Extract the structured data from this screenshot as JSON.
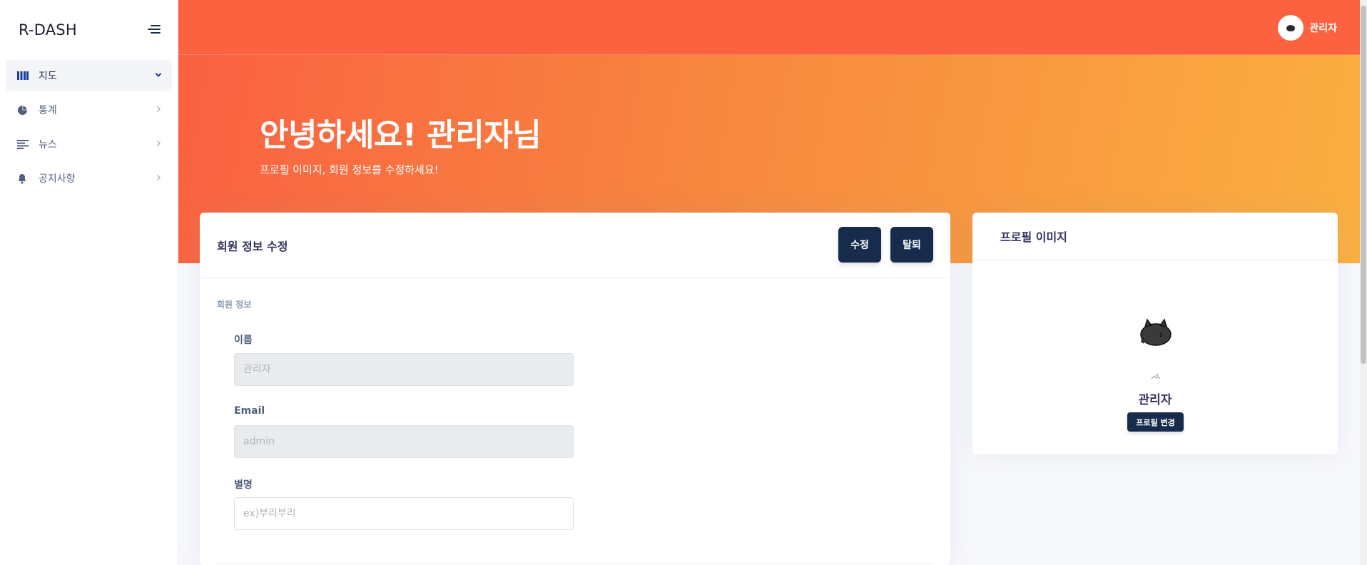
{
  "sidebar": {
    "brand": "R-DASH",
    "items": [
      {
        "label": "지도",
        "icon": "map-icon",
        "active": true
      },
      {
        "label": "통계",
        "icon": "pie-chart-icon",
        "active": false
      },
      {
        "label": "뉴스",
        "icon": "news-lines-icon",
        "active": false
      },
      {
        "label": "공지사항",
        "icon": "bell-icon",
        "active": false
      }
    ]
  },
  "topbar": {
    "user_name": "관리자",
    "background": "#fc6140"
  },
  "hero": {
    "title": "안녕하세요! 관리자님",
    "subtitle": "프로필 이미지, 회원 정보를 수정하세요!",
    "gradient_from": "#fa6142",
    "gradient_to": "#fbb040"
  },
  "member_card": {
    "title": "회원 정보 수정",
    "edit_button": "수정",
    "leave_button": "탈퇴",
    "section_label": "회원 정보",
    "fields": [
      {
        "label": "이름",
        "value": "",
        "placeholder": "관리자",
        "disabled": true
      },
      {
        "label": "Email",
        "value": "",
        "placeholder": "admin",
        "disabled": true
      },
      {
        "label": "별명",
        "value": "",
        "placeholder": "ex)부리부리",
        "disabled": false
      }
    ]
  },
  "profile_card": {
    "title": "프로필 이미지",
    "name": "관리자",
    "change_button": "프로필 변경"
  },
  "colors": {
    "button_dark": "#172b4d",
    "accent_blue": "#1a3d9e"
  }
}
